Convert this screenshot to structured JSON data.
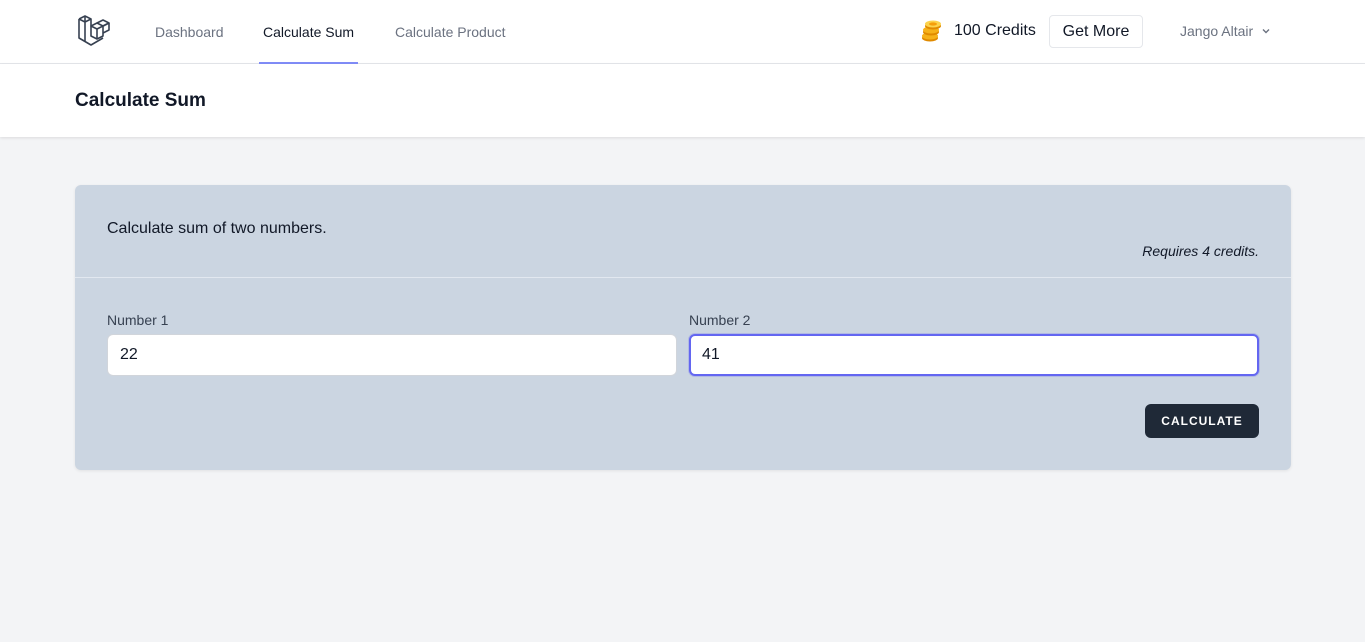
{
  "nav": {
    "links": [
      {
        "label": "Dashboard"
      },
      {
        "label": "Calculate Sum"
      },
      {
        "label": "Calculate Product"
      }
    ],
    "active_index": 1,
    "credits_label": "100 Credits",
    "get_more_label": "Get More",
    "user_name": "Jango Altair",
    "icons": {
      "logo": "laravel-logo",
      "coins": "coins-icon",
      "dropdown": "chevron-down-icon"
    }
  },
  "header": {
    "title": "Calculate Sum"
  },
  "card": {
    "description": "Calculate sum of two numbers.",
    "requirement": "Requires 4 credits.",
    "fields": [
      {
        "label": "Number 1",
        "value": "22"
      },
      {
        "label": "Number 2",
        "value": "41",
        "focused": true
      }
    ],
    "button_label": "CALCULATE"
  },
  "colors": {
    "accent": "#6366f1",
    "card_bg": "#cbd5e1",
    "button_bg": "#1f2937",
    "page_bg": "#f3f4f6"
  }
}
